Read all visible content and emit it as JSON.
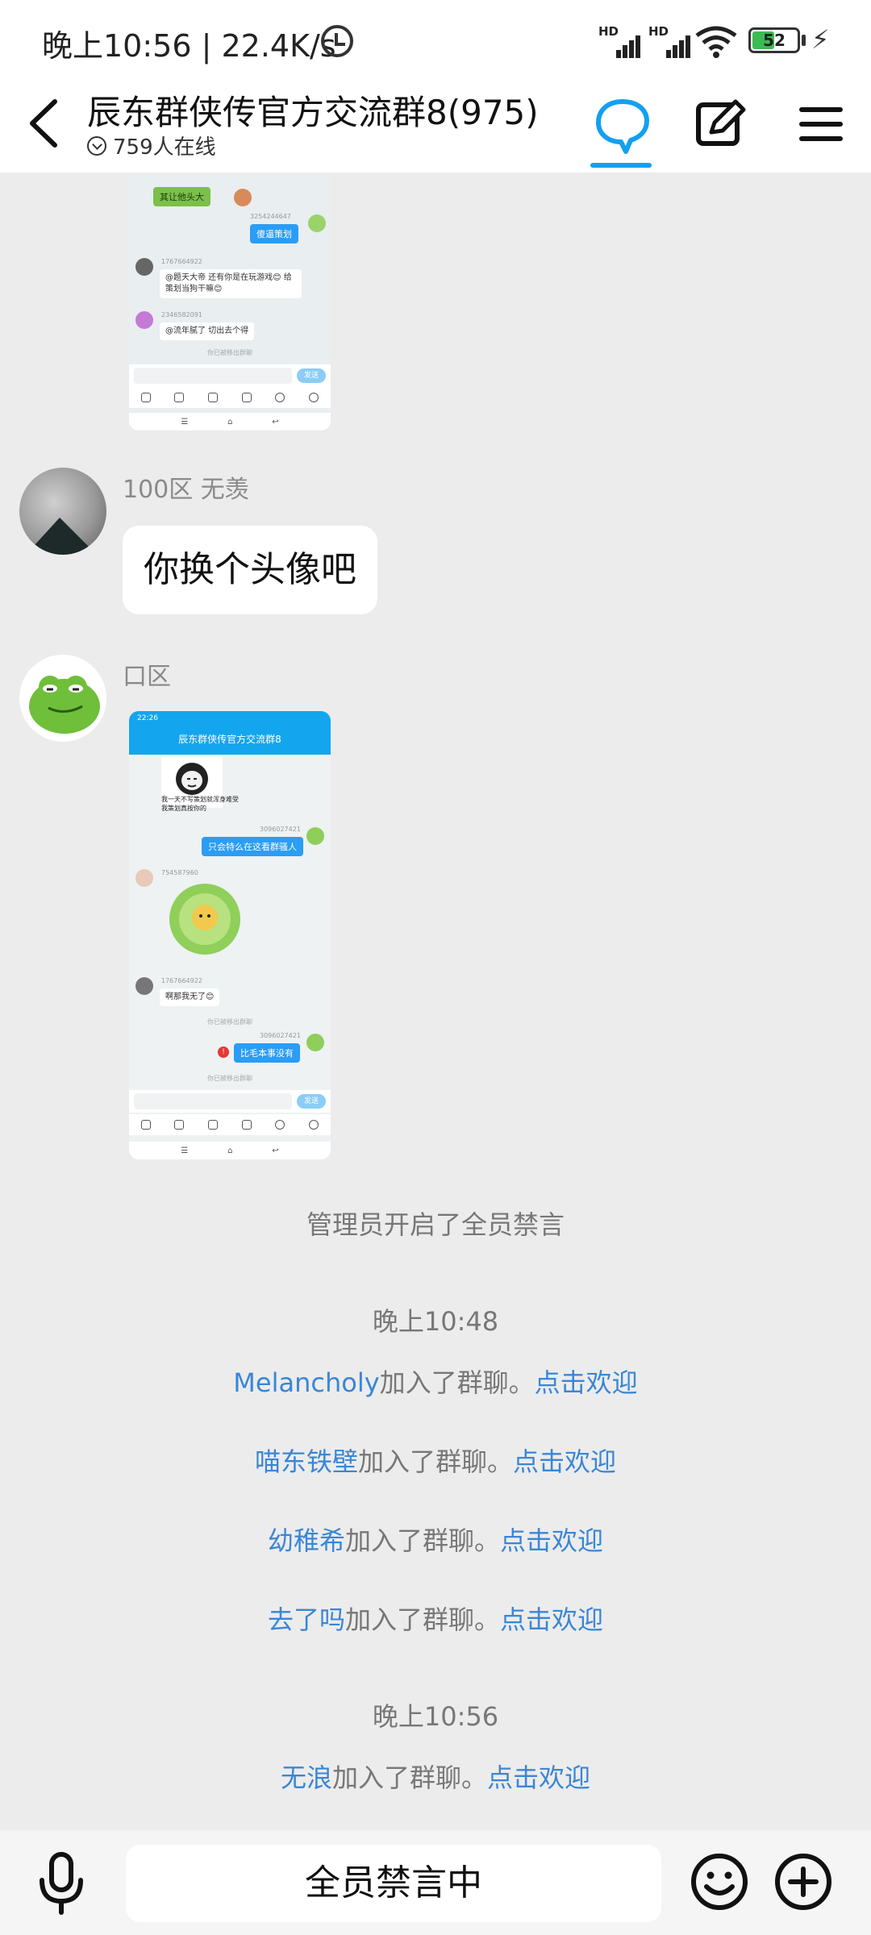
{
  "status_bar": {
    "time": "晚上10:56 | 22.4K/s",
    "hd_label": "HD",
    "battery": "52",
    "icons": [
      "alarm-icon",
      "signal-icon",
      "wifi-icon",
      "battery-icon",
      "charging-icon"
    ]
  },
  "header": {
    "title": "辰东群侠传官方交流群8(975)",
    "online": "759人在线",
    "icons": [
      "back-icon",
      "chat-bubble-icon",
      "edit-icon",
      "menu-icon"
    ]
  },
  "shot1": {
    "top_bubble": "其让他头大",
    "out_meta": "3254244647",
    "out_msg": "傻逼策划",
    "in1_meta": "1767664922",
    "in1_msg": "@题天大帝 还有你是在玩游戏😊 给策划当狗干嘛😊",
    "in2_meta": "2346582091",
    "in2_msg": "@流年腻了 切出去个得",
    "note": "你已被移出群聊",
    "send": "发送"
  },
  "messages": [
    {
      "sender": "100区  无羡",
      "text": "你换个头像吧"
    },
    {
      "sender": "口区"
    }
  ],
  "shot2": {
    "status_time": "22:26",
    "title": "辰东群侠传官方交流群8",
    "caption": "我一天不写策划就浑身难受 我策划真按你的",
    "out1_meta": "3096027421",
    "out1_msg": "只会特么在这看群骚人",
    "in1_meta": "754587960",
    "in2_meta": "1767664922",
    "in2_msg": "啊那我无了😊",
    "note": "你已被移出群聊",
    "out2_meta": "3096027421",
    "out2_msg": "比毛本事没有",
    "note2": "你已被移出群聊",
    "send": "发送"
  },
  "system": {
    "mute_all": "管理员开启了全员禁言",
    "time1": "晚上10:48",
    "joins1": [
      {
        "user": "Melancholy",
        "action": "加入了群聊。",
        "welcome": "点击欢迎"
      },
      {
        "user": "喵东铁壁",
        "action": "加入了群聊。",
        "welcome": "点击欢迎"
      },
      {
        "user": "幼稚希",
        "action": "加入了群聊。",
        "welcome": "点击欢迎"
      },
      {
        "user": "去了吗",
        "action": "加入了群聊。",
        "welcome": "点击欢迎"
      }
    ],
    "time2": "晚上10:56",
    "joins2": [
      {
        "user": "无浪",
        "action": "加入了群聊。",
        "welcome": "点击欢迎"
      }
    ]
  },
  "bottom_bar": {
    "muted_text": "全员禁言中",
    "icons": [
      "mic-icon",
      "emoji-icon",
      "plus-icon"
    ]
  },
  "colors": {
    "accent": "#13a0f0",
    "link": "#3a86d6",
    "system_text": "#777777",
    "background": "#ececec"
  }
}
